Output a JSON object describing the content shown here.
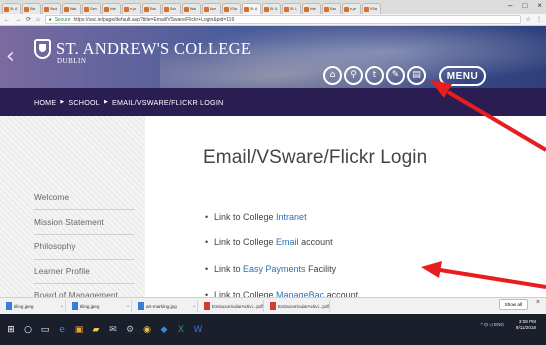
{
  "browser": {
    "tabs": [
      {
        "label": "St. A"
      },
      {
        "label": "Sta"
      },
      {
        "label": "Stud"
      },
      {
        "label": "Nati"
      },
      {
        "label": "Gen"
      },
      {
        "label": "Inte"
      },
      {
        "label": "e-pr"
      },
      {
        "label": "Eas"
      },
      {
        "label": "Sch"
      },
      {
        "label": "Wat"
      },
      {
        "label": "Ann"
      },
      {
        "label": "VSw"
      },
      {
        "label": "St. A"
      },
      {
        "label": "St. A"
      },
      {
        "label": "St. L"
      },
      {
        "label": "Inte"
      },
      {
        "label": "Eas"
      },
      {
        "label": "e-pr"
      },
      {
        "label": "VSw"
      }
    ],
    "window_controls": [
      "–",
      "□",
      "×"
    ],
    "secure_label": "Secure",
    "url": "https://sac.ie/page/default.asp?title=Email/VSware/Flickr+Login&pid=119"
  },
  "site": {
    "college_name": "ST. ANDREW'S COLLEGE",
    "college_sub": "DUBLIN",
    "menu_label": "MENU",
    "header_icons": [
      {
        "name": "home-icon",
        "glyph": "⌂"
      },
      {
        "name": "search-icon",
        "glyph": "⚲"
      },
      {
        "name": "twitter-icon",
        "glyph": "t"
      },
      {
        "name": "wrench-icon",
        "glyph": "✎"
      },
      {
        "name": "document-icon",
        "glyph": "▤"
      }
    ]
  },
  "breadcrumb": {
    "items": [
      "HOME",
      "SCHOOL",
      "EMAIL/VSWARE/FLICKR LOGIN"
    ],
    "separator": "▶"
  },
  "sidebar": {
    "items": [
      {
        "label": "Welcome"
      },
      {
        "label": "Mission Statement"
      },
      {
        "label": "Philosophy"
      },
      {
        "label": "Learner Profile"
      },
      {
        "label": "Board of Management"
      }
    ]
  },
  "main": {
    "title": "Email/VSware/Flickr Login",
    "links": [
      {
        "prefix": "Link to College ",
        "link": "Intranet",
        "suffix": ""
      },
      {
        "prefix": "Link to College ",
        "link": "Email",
        "suffix": " account"
      },
      {
        "prefix": "Link to ",
        "link": "Easy Payments",
        "suffix": " Facility"
      },
      {
        "prefix": "Link to College ",
        "link": "ManageBac",
        "suffix": " account"
      }
    ]
  },
  "downloads": {
    "items": [
      {
        "name": "tiling.jpeg",
        "type": "image"
      },
      {
        "name": "tiling.jpeg",
        "type": "image"
      },
      {
        "name": "art-marking.jpg",
        "type": "image"
      },
      {
        "name": "ExtracurricularActivi...pdf",
        "type": "pdf"
      },
      {
        "name": "ExtracurricularActivi...pdf",
        "type": "pdf"
      }
    ],
    "show_all_label": "Show all"
  },
  "taskbar": {
    "time": "3:08 PM",
    "date": "9/11/2018",
    "tray": "^ ⊡ ◁ ENG"
  },
  "colors": {
    "header_bg": "#2e3f7c",
    "breadcrumb_bg": "#2a1d52",
    "link": "#2f6db5",
    "annotation_arrow": "#e81d1d"
  }
}
